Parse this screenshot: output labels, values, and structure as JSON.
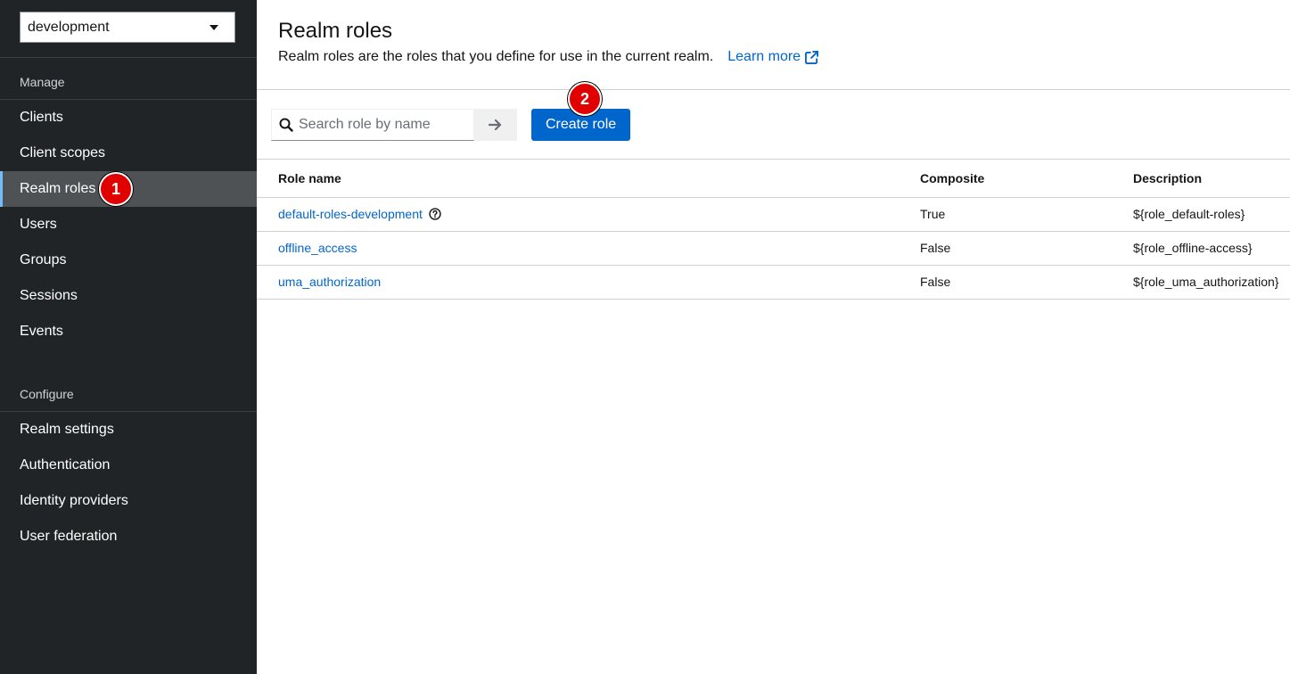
{
  "sidebar": {
    "realm_select": "development",
    "manage_title": "Manage",
    "manage_items": [
      {
        "label": "Clients"
      },
      {
        "label": "Client scopes"
      },
      {
        "label": "Realm roles"
      },
      {
        "label": "Users"
      },
      {
        "label": "Groups"
      },
      {
        "label": "Sessions"
      },
      {
        "label": "Events"
      }
    ],
    "configure_title": "Configure",
    "configure_items": [
      {
        "label": "Realm settings"
      },
      {
        "label": "Authentication"
      },
      {
        "label": "Identity providers"
      },
      {
        "label": "User federation"
      }
    ]
  },
  "badges": {
    "one": "1",
    "two": "2"
  },
  "main": {
    "title": "Realm roles",
    "description": "Realm roles are the roles that you define for use in the current realm.",
    "learn_more": "Learn more",
    "search_placeholder": "Search role by name",
    "create_button": "Create role",
    "table": {
      "headers": [
        "Role name",
        "Composite",
        "Description"
      ],
      "rows": [
        {
          "name": "default-roles-development",
          "composite": "True",
          "description": "${role_default-roles}"
        },
        {
          "name": "offline_access",
          "composite": "False",
          "description": "${role_offline-access}"
        },
        {
          "name": "uma_authorization",
          "composite": "False",
          "description": "${role_uma_authorization}"
        }
      ]
    }
  },
  "colors": {
    "accent": "#0066cc",
    "sidebar_bg": "#212427",
    "badge": "#e00000"
  }
}
